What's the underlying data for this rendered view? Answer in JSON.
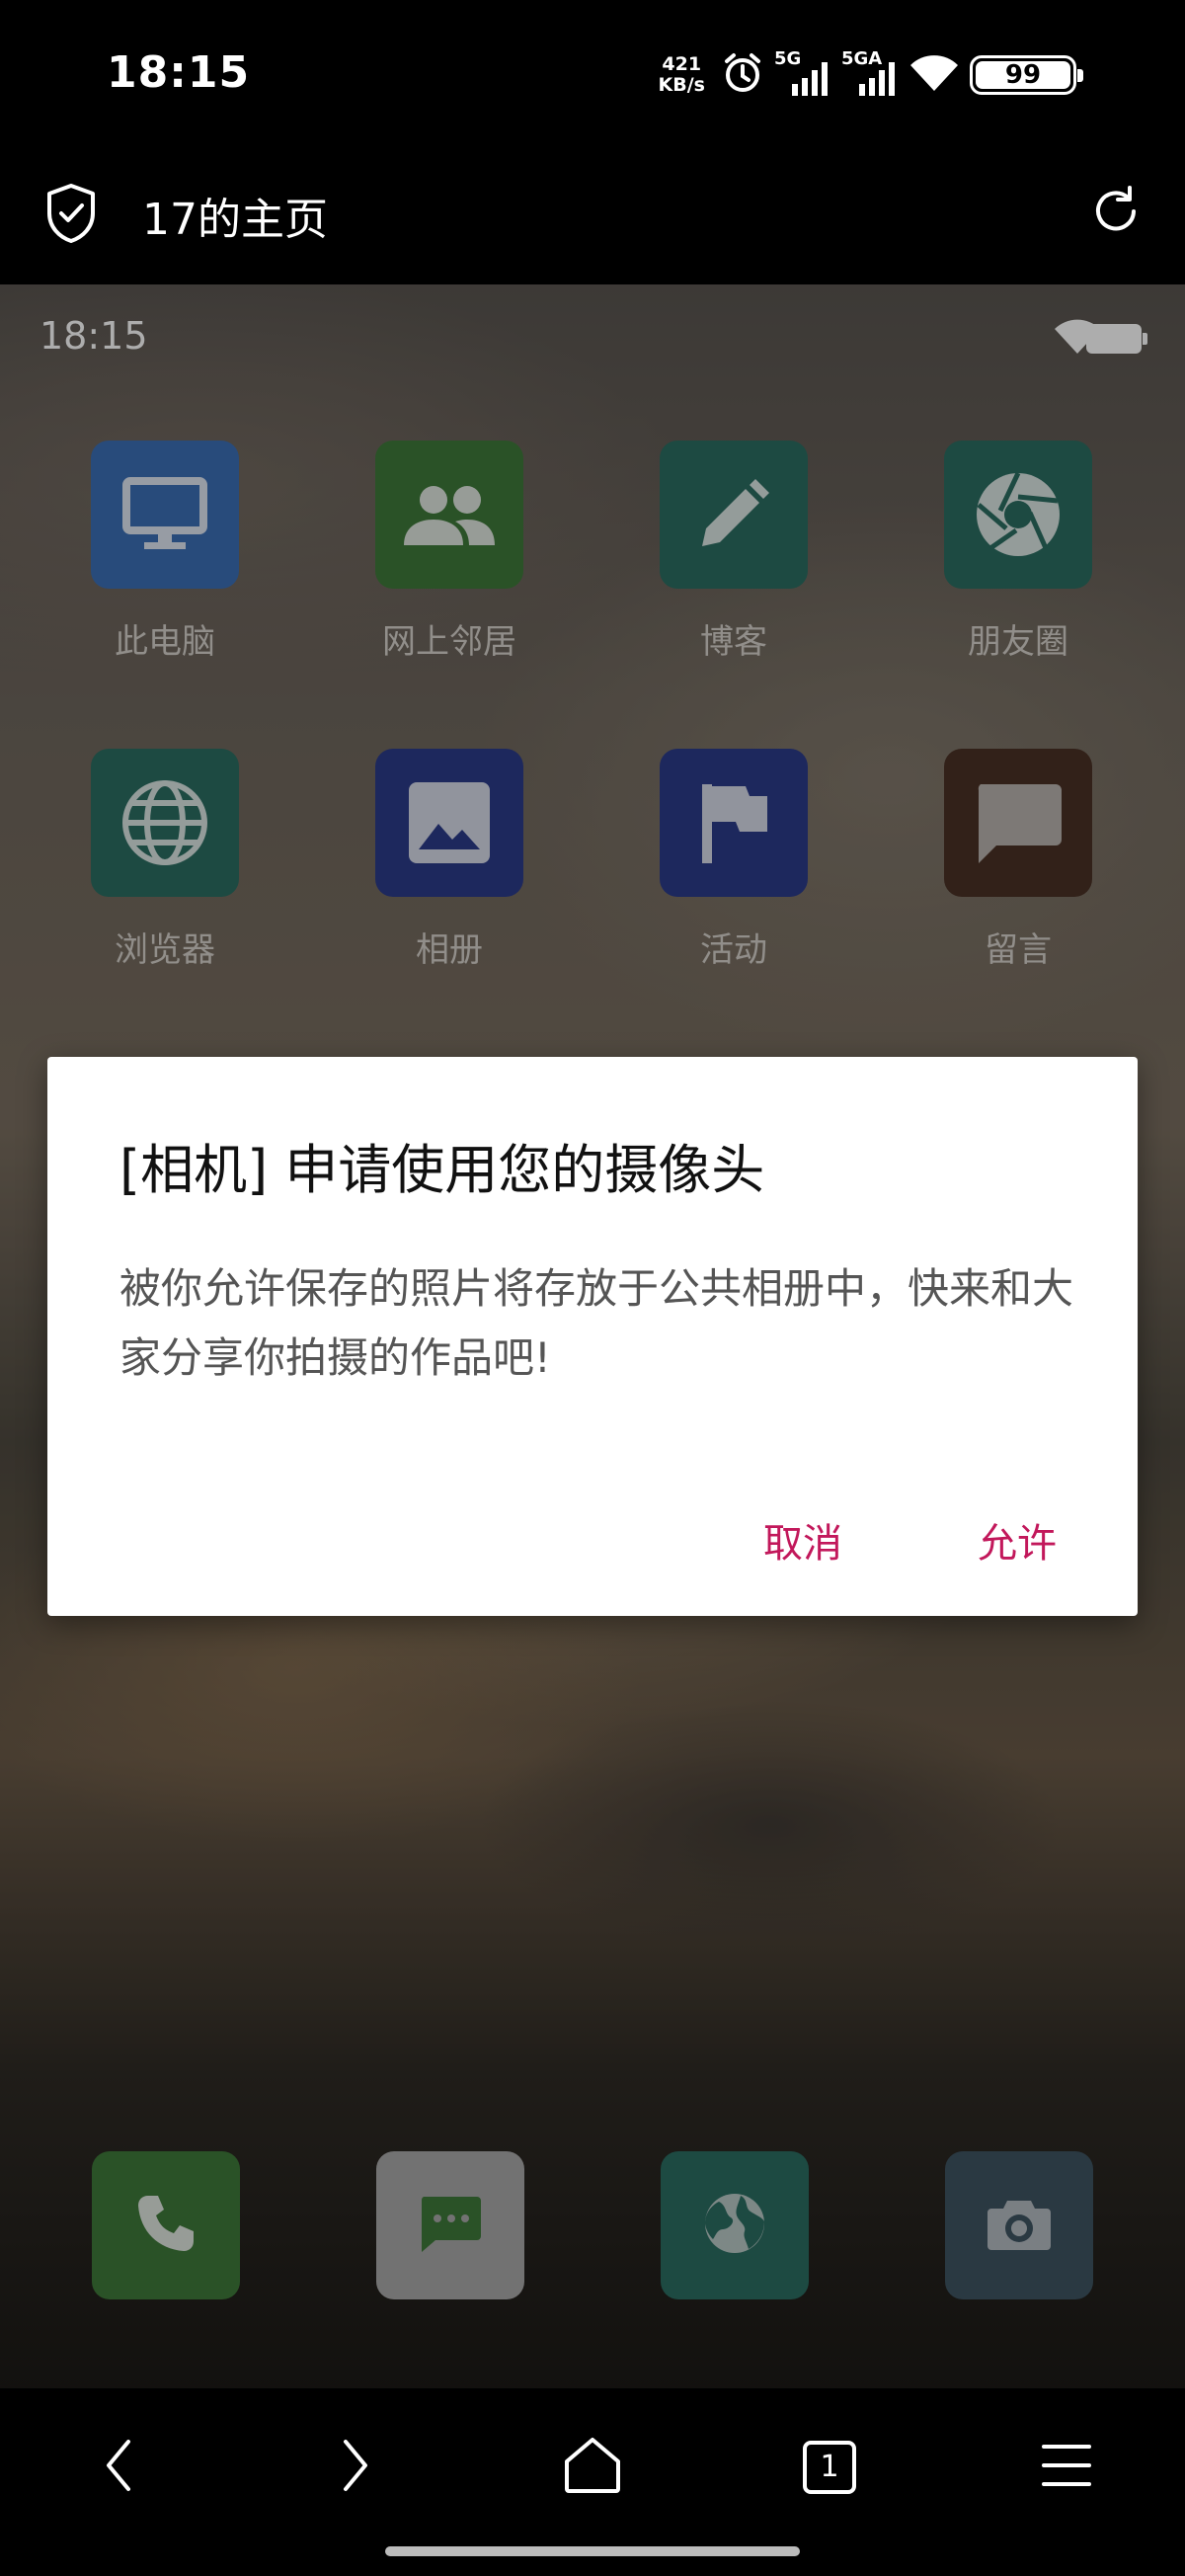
{
  "status_bar": {
    "time": "18:15",
    "net_speed_value": "421",
    "net_speed_unit": "KB/s",
    "sim1_label": "5G",
    "sim2_label": "5GA",
    "battery": "99"
  },
  "browser": {
    "page_title": "17的主页"
  },
  "launcher": {
    "time": "18:15",
    "apps": [
      {
        "label": "此电脑",
        "icon": "computer-icon",
        "color": "#3b6fb6"
      },
      {
        "label": "网上邻居",
        "icon": "people-icon",
        "color": "#3f7a3a"
      },
      {
        "label": "博客",
        "icon": "pencil-icon",
        "color": "#2b6d62"
      },
      {
        "label": "朋友圈",
        "icon": "camera-shutter-icon",
        "color": "#2b6d62"
      },
      {
        "label": "浏览器",
        "icon": "globe-icon",
        "color": "#2b6d62"
      },
      {
        "label": "相册",
        "icon": "image-icon",
        "color": "#2c3b8a"
      },
      {
        "label": "活动",
        "icon": "flag-icon",
        "color": "#2c3b8a"
      },
      {
        "label": "留言",
        "icon": "message-icon",
        "color": "#4a3125"
      }
    ],
    "dock": [
      {
        "icon": "phone-icon",
        "color": "#3f7a3a"
      },
      {
        "icon": "chat-icon",
        "color": "#a9a9a9"
      },
      {
        "icon": "globe-icon",
        "color": "#2b6d62"
      },
      {
        "icon": "camera-icon",
        "color": "#3e5462"
      }
    ]
  },
  "dialog": {
    "title": "[相机] 申请使用您的摄像头",
    "body": "被你允许保存的照片将存放于公共相册中，快来和大家分享你拍摄的作品吧!",
    "cancel_label": "取消",
    "allow_label": "允许",
    "accent_color": "#c2185b"
  },
  "bottom_nav": {
    "tab_count": "1"
  }
}
